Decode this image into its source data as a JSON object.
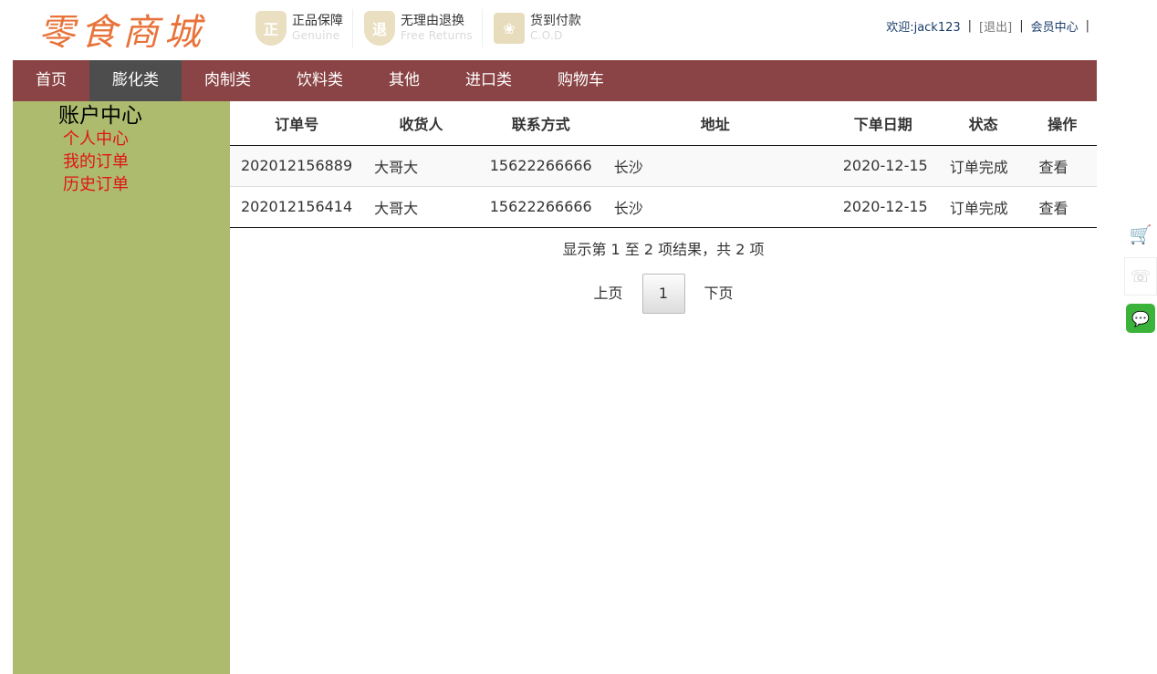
{
  "header": {
    "logo": "零食商城",
    "promises": [
      {
        "badge": "正",
        "cn": "正品保障",
        "en": "Genuine"
      },
      {
        "badge": "退",
        "cn": "无理由退换",
        "en": "Free Returns"
      },
      {
        "badge": "❀",
        "cn": "货到付款",
        "en": "C.O.D"
      }
    ],
    "user": {
      "welcome": "欢迎:jack123",
      "logout": "[退出]",
      "member_center": "会员中心",
      "separator": "|"
    }
  },
  "nav": {
    "items": [
      "首页",
      "膨化类",
      "肉制类",
      "饮料类",
      "其他",
      "进口类",
      "购物车"
    ],
    "active": "膨化类",
    "bg_color": "#8b4445",
    "active_color": "#4d4d4d"
  },
  "sidebar": {
    "title": "账户中心",
    "links": [
      "个人中心",
      "我的订单",
      "历史订单"
    ],
    "bg_color": "#adbb6f",
    "link_color": "#e01515"
  },
  "orders": {
    "columns": [
      "订单号",
      "收货人",
      "联系方式",
      "地址",
      "下单日期",
      "状态",
      "操作"
    ],
    "rows": [
      {
        "order_no": "202012156889",
        "receiver": "大哥大",
        "phone": "15622266666",
        "address": "长沙",
        "date": "2020-12-15",
        "status": "订单完成",
        "action": "查看"
      },
      {
        "order_no": "202012156414",
        "receiver": "大哥大",
        "phone": "15622266666",
        "address": "长沙",
        "date": "2020-12-15",
        "status": "订单完成",
        "action": "查看"
      }
    ],
    "info": "显示第 1 至 2 项结果，共 2 项",
    "pager": {
      "prev": "上页",
      "current": "1",
      "next": "下页"
    }
  },
  "floattools": {
    "cart_icon": "🛒",
    "phone_icon": "☏",
    "wechat_icon": "💬"
  }
}
